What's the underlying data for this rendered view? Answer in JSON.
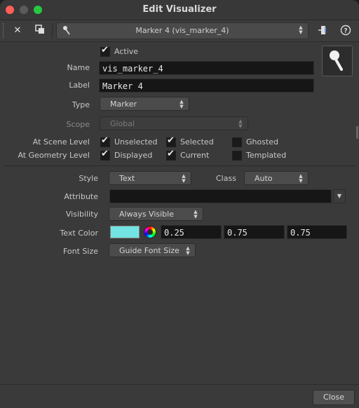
{
  "window": {
    "title": "Edit Visualizer"
  },
  "toolbar": {
    "close_icon": "close-icon",
    "copy_icon": "copy-window-icon",
    "visualizer_select": "Marker 4 (vis_marker_4)",
    "help_label": "?"
  },
  "form": {
    "active_label": "Active",
    "active_checked": true,
    "name_label": "Name",
    "name_value": "vis_marker_4",
    "label_label": "Label",
    "label_value": "Marker 4",
    "type_label": "Type",
    "type_value": "Marker",
    "scope_label": "Scope",
    "scope_value": "Global",
    "scene_level_label": "At Scene Level",
    "geometry_level_label": "At Geometry Level",
    "scene_unselected": "Unselected",
    "scene_selected": "Selected",
    "scene_ghosted": "Ghosted",
    "geo_displayed": "Displayed",
    "geo_current": "Current",
    "geo_templated": "Templated"
  },
  "params": {
    "style_label": "Style",
    "style_value": "Text",
    "class_label": "Class",
    "class_value": "Auto",
    "attribute_label": "Attribute",
    "attribute_value": "",
    "visibility_label": "Visibility",
    "visibility_value": "Always Visible",
    "text_color_label": "Text Color",
    "text_color_hex": "#73e3e3",
    "color_r": "0.25",
    "color_g": "0.75",
    "color_b": "0.75",
    "font_size_label": "Font Size",
    "font_size_value": "Guide Font Size"
  },
  "footer": {
    "close_label": "Close"
  }
}
